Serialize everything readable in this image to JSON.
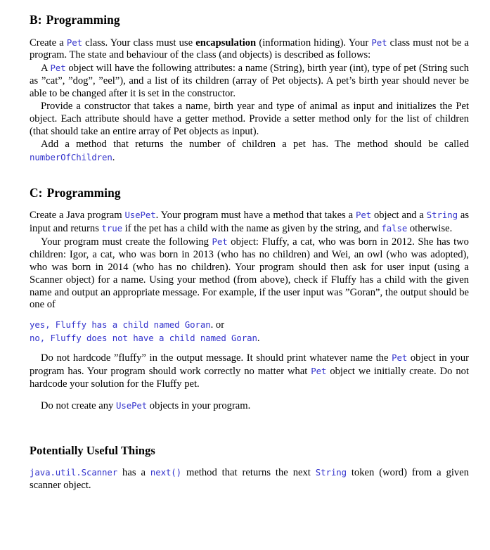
{
  "document": {
    "accent_code_color": "#3333cc",
    "text_color": "#000000",
    "background_color": "#ffffff"
  },
  "sections": {
    "b": {
      "label": "B:",
      "title": "Programming",
      "p1": {
        "t1": "Create a ",
        "c1": "Pet",
        "t2": " class.  Your class must use ",
        "b1": "encapsulation",
        "t3": " (information hiding).  Your ",
        "c2": "Pet",
        "t4": " class must not be a program.  The state and behaviour of the class (and objects) is described as follows:"
      },
      "p2": {
        "t1": "A ",
        "c1": "Pet",
        "t2": " object will have the following attributes: a name (String), birth year (int), type of pet (String such as ”cat”, ”dog”, ”eel”), and a list of its children (array of Pet objects). A pet’s birth year should never be able to be changed after it is set in the constructor."
      },
      "p3": "Provide a constructor that takes a name, birth year and type of animal as input and initializes the Pet object.  Each attribute should have a getter method.  Provide a setter method only for the list of children (that should take an entire array of Pet objects as input).",
      "p4": {
        "t1": "Add a method that returns the number of children a pet has.  The method should be called ",
        "c1": "numberOfChildren",
        "t2": "."
      }
    },
    "c": {
      "label": "C:",
      "title": "Programming",
      "p1": {
        "t1": "Create a Java program ",
        "c1": "UsePet",
        "t2": ".  Your program must have a method that takes a ",
        "c2": "Pet",
        "t3": " object and a ",
        "c3": "String",
        "t4": " as input and returns ",
        "c4": "true",
        "t5": " if the pet has a child with the name as given by the string, and ",
        "c5": "false",
        "t6": " otherwise."
      },
      "p2": {
        "t1": "Your program must create the following ",
        "c1": "Pet",
        "t2": " object: Fluffy, a cat, who was born in 2012. She has two children: Igor, a cat, who was born in 2013 (who has no children) and Wei, an owl (who was adopted), who was born in 2014 (who has no children).  Your program should then ask for user input (using a Scanner object) for a name.  Using your method (from above), check if Fluffy has a child with the given name and output an appropriate message.  For example, if the user input was ”Goran”, the output should be one of"
      },
      "output_lines": [
        {
          "code": "yes, Fluffy has a child named Goran",
          "tail": ". or"
        },
        {
          "code": "no, Fluffy does not have a child named Goran",
          "tail": "."
        }
      ],
      "p3": {
        "t1": "Do not hardcode ”fluffy” in the output message. It should print whatever name the ",
        "c1": "Pet",
        "t2": " object in your program has. Your program should work correctly no matter what ",
        "c2": "Pet",
        "t3": " object we initially create.  Do not hardcode your solution for the Fluffy pet."
      },
      "p4": {
        "t1": "Do not create any ",
        "c1": "UsePet",
        "t2": " objects in your program."
      }
    },
    "useful": {
      "title": "Potentially Useful Things",
      "p1": {
        "c1": "java.util.Scanner",
        "t1": " has a ",
        "c2": "next()",
        "t2": " method that returns the next ",
        "c3": "String",
        "t3": " token (word) from a given scanner object."
      }
    }
  }
}
